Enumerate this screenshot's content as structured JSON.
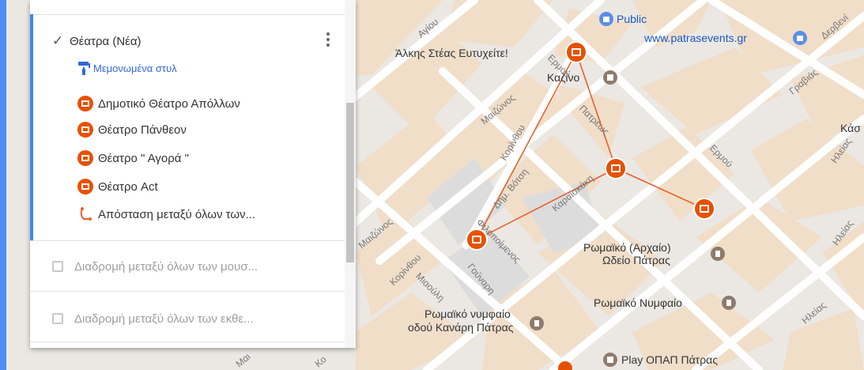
{
  "panel": {
    "layer_title": "Θέατρα (Νέα)",
    "style_link": "Μεμονωμένα στυλ",
    "items": [
      {
        "label": "Δημοτικό Θέατρο Απόλλων"
      },
      {
        "label": "Θέατρο Πάνθεον"
      },
      {
        "label": "Θέατρο \" Αγορά \""
      },
      {
        "label": "Θέατρο Act"
      },
      {
        "label": "Απόσταση μεταξύ όλων των..."
      }
    ],
    "layers": [
      {
        "label": "Διαδρομή μεταξύ όλων των μουσ..."
      },
      {
        "label": "Διαδρομή μεταξύ όλων των εκθε..."
      }
    ]
  },
  "map": {
    "places": {
      "public": "Public",
      "patras_events": "www.patrasevents.gr",
      "alkis": "Άλκης Στέας Ευτυχείτε!",
      "kazino": "Καζίνο",
      "kas": "Κάσ",
      "odeio_1": "Ρωμαϊκό (Αρχαίο)",
      "odeio_2": "Ωδείο Πάτρας",
      "nymfaio": "Ρωμαϊκό Νυμφαίο",
      "nymfaio_kanari_1": "Ρωμαϊκό νυμφαίο",
      "nymfaio_kanari_2": "οδού Κανάρη Πάτρας",
      "opap": "Play ΟΠΑΠ Πάτρας"
    },
    "streets": {
      "agiou": "Αγίου",
      "maizonos_1": "Μαιζώνος",
      "maizonos_2": "Μαιζώνος",
      "maizonos_3": "Μαι",
      "korinthou_1": "Κορίνθου",
      "korinthou_2": "Κορίνθου",
      "patreos": "Πατρέως",
      "ermou_1": "Ερμού",
      "ermou_2": "Ερμού",
      "dim_votsi": "Δημ. Βότση",
      "filopimenos": "Φιλοποίμενος",
      "karaiskaki": "Καραϊσκάκη",
      "miaouli": "Μιαούλη",
      "grabias": "Γραβιάς",
      "derbeni": "Δερβενί",
      "ileias_1": "Ηλείας",
      "ileias_2": "Ηλείας",
      "ileias_3": "Ηλείας",
      "gounari": "Γούναρη",
      "ko": "Κο"
    },
    "colors": {
      "land": "#ece7df",
      "block_beige": "#f1dfcb",
      "road": "#ffffff",
      "route": "#e8602c",
      "pin": "#e65100",
      "poi_gray": "#8d7b6c",
      "accent_blue": "#4285f4"
    }
  }
}
